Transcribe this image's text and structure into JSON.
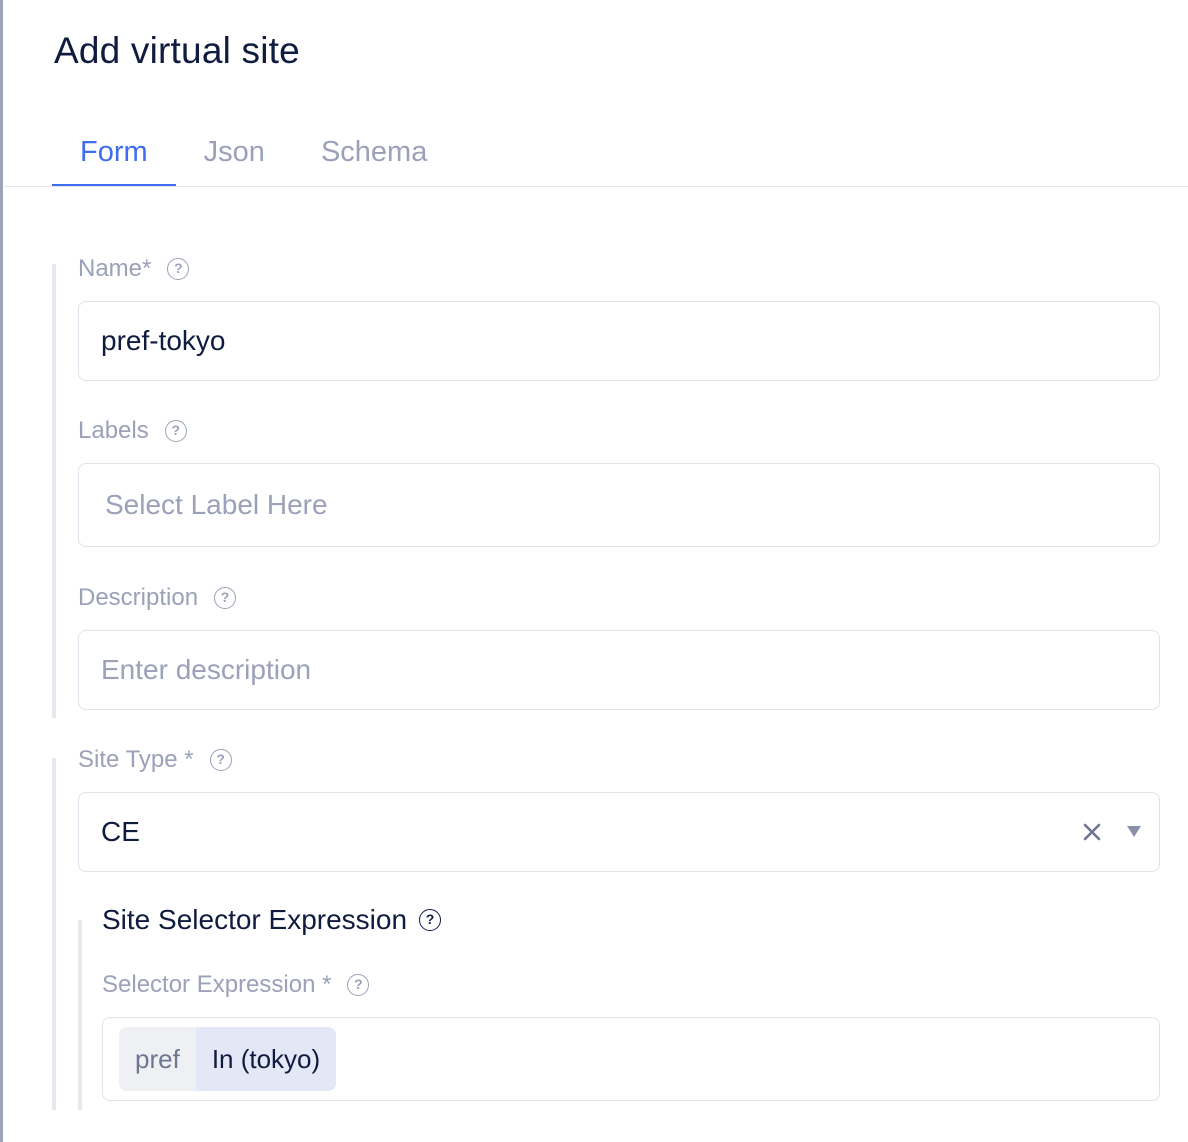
{
  "dialog": {
    "title": "Add virtual site"
  },
  "tabs": [
    {
      "label": "Form",
      "active": true
    },
    {
      "label": "Json",
      "active": false
    },
    {
      "label": "Schema",
      "active": false
    }
  ],
  "form": {
    "name": {
      "label": "Name*",
      "value": "pref-tokyo",
      "help_icon": "question-circle-icon"
    },
    "labels": {
      "label": "Labels",
      "placeholder": "Select Label Here",
      "help_icon": "question-circle-icon"
    },
    "description": {
      "label": "Description",
      "placeholder": "Enter description",
      "help_icon": "question-circle-icon"
    },
    "site_type": {
      "label": "Site Type *",
      "value": "CE",
      "clear_icon": "close-icon",
      "dropdown_icon": "caret-down-icon",
      "help_icon": "question-circle-icon"
    },
    "site_selector": {
      "section_title": "Site Selector Expression",
      "expression_label": "Selector Expression *",
      "chip_key": "pref",
      "chip_operator": "In (tokyo)",
      "help_icon": "question-circle-icon"
    }
  },
  "colors": {
    "accent": "#3e6df0",
    "text_primary": "#0f1b3f",
    "text_muted": "#9aa1b9",
    "border": "#e0e3eb"
  }
}
